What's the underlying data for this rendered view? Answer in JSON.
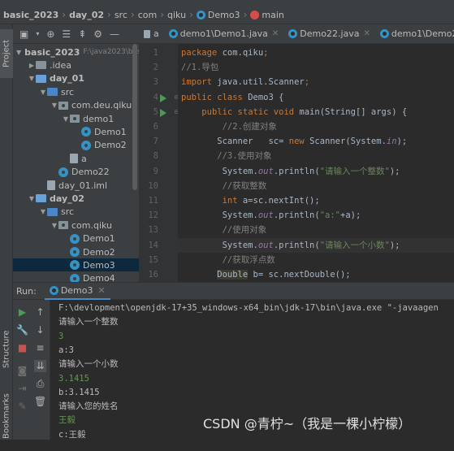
{
  "breadcrumb": [
    "basic_2023",
    "day_02",
    "src",
    "com",
    "qiku",
    "Demo3",
    "main"
  ],
  "left_strip": {
    "project": "Project",
    "structure": "Structure",
    "bookmarks": "Bookmarks"
  },
  "project_tree": [
    {
      "label": "basic_2023",
      "note": "F:\\java2023\\bas",
      "depth": 0,
      "kind": "folder-blue",
      "arrow": "down",
      "bold": true
    },
    {
      "label": ".idea",
      "depth": 1,
      "kind": "folder",
      "arrow": "right"
    },
    {
      "label": "day_01",
      "depth": 1,
      "kind": "folder-blue",
      "arrow": "down",
      "bold": true
    },
    {
      "label": "src",
      "depth": 2,
      "kind": "folder-src",
      "arrow": "down"
    },
    {
      "label": "com.deu.qiku",
      "depth": 3,
      "kind": "package",
      "arrow": "down"
    },
    {
      "label": "demo1",
      "depth": 4,
      "kind": "package",
      "arrow": "down"
    },
    {
      "label": "Demo1",
      "depth": 5,
      "kind": "class"
    },
    {
      "label": "Demo2",
      "depth": 5,
      "kind": "class"
    },
    {
      "label": "a",
      "depth": 4,
      "kind": "file"
    },
    {
      "label": "Demo22",
      "depth": 3,
      "kind": "class"
    },
    {
      "label": "day_01.iml",
      "depth": 2,
      "kind": "file"
    },
    {
      "label": "day_02",
      "depth": 1,
      "kind": "folder-blue",
      "arrow": "down",
      "bold": true
    },
    {
      "label": "src",
      "depth": 2,
      "kind": "folder-src",
      "arrow": "down"
    },
    {
      "label": "com.qiku",
      "depth": 3,
      "kind": "package",
      "arrow": "down"
    },
    {
      "label": "Demo1",
      "depth": 4,
      "kind": "class"
    },
    {
      "label": "Demo2",
      "depth": 4,
      "kind": "class"
    },
    {
      "label": "Demo3",
      "depth": 4,
      "kind": "class",
      "selected": true
    },
    {
      "label": "Demo4",
      "depth": 4,
      "kind": "class"
    }
  ],
  "editor_tabs": [
    "a",
    "demo1\\Demo1.java",
    "Demo22.java",
    "demo1\\Demo2.ja"
  ],
  "line_numbers": [
    "1",
    "2",
    "3",
    "4",
    "5",
    "6",
    "7",
    "8",
    "9",
    "10",
    "11",
    "12",
    "13",
    "14",
    "15",
    "16"
  ],
  "code_lines": [
    [
      [
        "kw",
        "package "
      ],
      [
        "pk",
        "com.qiku"
      ],
      [
        "kw",
        ";"
      ]
    ],
    [
      [
        "cm",
        "//1.导包"
      ]
    ],
    [
      [
        "kw",
        "import "
      ],
      [
        "pk",
        "java.util.Scanner"
      ],
      [
        "kw",
        ";"
      ]
    ],
    [
      [
        "kw",
        "public class "
      ],
      [
        "cname",
        "Demo3 {"
      ]
    ],
    [
      [
        "pk",
        "    "
      ],
      [
        "kw",
        "public static void "
      ],
      [
        "cname",
        "main"
      ],
      [
        "pk",
        "(String[] args) {"
      ]
    ],
    [
      [
        "cm",
        "        //2.创建对象"
      ]
    ],
    [
      [
        "pk",
        "       Scanner   sc= "
      ],
      [
        "kw",
        "new "
      ],
      [
        "pk",
        "Scanner(System."
      ],
      [
        "fld",
        "in"
      ],
      [
        "pk",
        ");"
      ]
    ],
    [
      [
        "cm",
        "       //3.使用对象"
      ]
    ],
    [
      [
        "pk",
        "        System."
      ],
      [
        "fld",
        "out"
      ],
      [
        "pk",
        ".println("
      ],
      [
        "str",
        "\"请输入一个整数\""
      ],
      [
        "pk",
        ");"
      ]
    ],
    [
      [
        "cm",
        "        //获取整数"
      ]
    ],
    [
      [
        "kw",
        "        int "
      ],
      [
        "pk",
        "a=sc.nextInt();"
      ]
    ],
    [
      [
        "pk",
        "        System."
      ],
      [
        "fld",
        "out"
      ],
      [
        "pk",
        ".println("
      ],
      [
        "str",
        "\"a:\""
      ],
      [
        "pk",
        "+a);"
      ]
    ],
    [
      [
        "cm",
        "        //使用对象"
      ]
    ],
    [
      [
        "pk",
        "        System."
      ],
      [
        "fld",
        "out"
      ],
      [
        "pk",
        ".println("
      ],
      [
        "str",
        "\"请输入一个小数\""
      ],
      [
        "pk",
        ");"
      ]
    ],
    [
      [
        "cm",
        "        //获取浮点数"
      ]
    ],
    [
      [
        "pk",
        "       "
      ],
      [
        "tp",
        "Double"
      ],
      [
        "pk",
        " b= sc.nextDouble();"
      ]
    ]
  ],
  "run_panel": {
    "label": "Run:",
    "tab": "Demo3"
  },
  "console_lines": [
    {
      "text": "F:\\devlopment\\openjdk-17+35_windows-x64_bin\\jdk-17\\bin\\java.exe \"-javaagen",
      "input": false
    },
    {
      "text": "请输入一个整数",
      "input": false
    },
    {
      "text": "3",
      "input": true
    },
    {
      "text": "a:3",
      "input": false
    },
    {
      "text": "请输入一个小数",
      "input": false
    },
    {
      "text": "3.1415",
      "input": true
    },
    {
      "text": "b:3.1415",
      "input": false
    },
    {
      "text": "请输入您的姓名",
      "input": false
    },
    {
      "text": "王毅",
      "input": true
    },
    {
      "text": "c:王毅",
      "input": false
    }
  ],
  "watermark": "CSDN @青柠~（我是一棵小柠檬）"
}
